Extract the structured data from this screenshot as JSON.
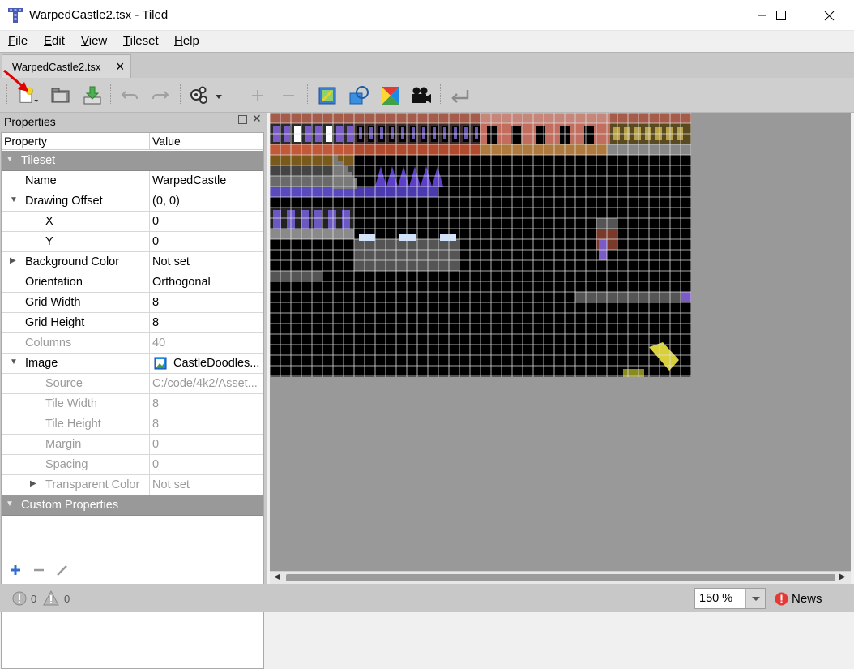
{
  "window": {
    "title": "WarpedCastle2.tsx - Tiled",
    "minimize_icon": "minimize-icon",
    "maximize_icon": "maximize-icon",
    "close_icon": "close-icon"
  },
  "menu": {
    "items": [
      {
        "label": "File",
        "access": "F"
      },
      {
        "label": "Edit",
        "access": "E"
      },
      {
        "label": "View",
        "access": "V"
      },
      {
        "label": "Tileset",
        "access": "T"
      },
      {
        "label": "Help",
        "access": "H"
      }
    ]
  },
  "tabs": [
    {
      "label": "WarpedCastle2.tsx",
      "close": "×"
    }
  ],
  "toolbar": {
    "buttons": [
      "new-file-icon",
      "open-icon",
      "save-icon",
      "undo-icon",
      "redo-icon",
      "settings-icon",
      "add-icon",
      "remove-icon",
      "embed-tileset-icon",
      "shape-icon",
      "color-icon",
      "animation-icon",
      "back-icon"
    ]
  },
  "properties_panel": {
    "title": "Properties",
    "col_property": "Property",
    "col_value": "Value",
    "rows": [
      {
        "name": "Tileset",
        "value": "",
        "kind": "group",
        "indent": 0,
        "expander": "▼"
      },
      {
        "name": "Name",
        "value": "WarpedCastle",
        "kind": "normal",
        "indent": 1,
        "expander": ""
      },
      {
        "name": "Drawing Offset",
        "value": "(0, 0)",
        "kind": "normal",
        "indent": 1,
        "expander": "▼"
      },
      {
        "name": "X",
        "value": "0",
        "kind": "normal",
        "indent": 2,
        "expander": ""
      },
      {
        "name": "Y",
        "value": "0",
        "kind": "normal",
        "indent": 2,
        "expander": ""
      },
      {
        "name": "Background Color",
        "value": "Not set",
        "kind": "normal",
        "indent": 1,
        "expander": "▶"
      },
      {
        "name": "Orientation",
        "value": "Orthogonal",
        "kind": "normal",
        "indent": 1,
        "expander": ""
      },
      {
        "name": "Grid Width",
        "value": "8",
        "kind": "normal",
        "indent": 1,
        "expander": ""
      },
      {
        "name": "Grid Height",
        "value": "8",
        "kind": "normal",
        "indent": 1,
        "expander": ""
      },
      {
        "name": "Columns",
        "value": "40",
        "kind": "dim",
        "indent": 1,
        "expander": ""
      },
      {
        "name": "Image",
        "value": "CastleDoodles...",
        "kind": "normal",
        "indent": 1,
        "expander": "▼"
      },
      {
        "name": "Source",
        "value": "C:/code/4k2/Asset...",
        "kind": "dim",
        "indent": 2,
        "expander": ""
      },
      {
        "name": "Tile Width",
        "value": "8",
        "kind": "dim",
        "indent": 2,
        "expander": ""
      },
      {
        "name": "Tile Height",
        "value": "8",
        "kind": "dim",
        "indent": 2,
        "expander": ""
      },
      {
        "name": "Margin",
        "value": "0",
        "kind": "dim",
        "indent": 2,
        "expander": ""
      },
      {
        "name": "Spacing",
        "value": "0",
        "kind": "dim",
        "indent": 2,
        "expander": ""
      },
      {
        "name": "Transparent Color",
        "value": "Not set",
        "kind": "dim",
        "indent": 2,
        "expander": "▶"
      },
      {
        "name": "Custom Properties",
        "value": "",
        "kind": "group",
        "indent": 0,
        "expander": "▼"
      }
    ],
    "bottom_buttons": [
      "add-property-icon",
      "remove-property-icon",
      "rename-property-icon"
    ]
  },
  "status": {
    "errors": "0",
    "warnings": "0",
    "zoom": "150 %",
    "news": "News"
  },
  "colors": {
    "title_bar": "#ffffff",
    "panel_bg": "#c8c8c8",
    "group_row": "#999999",
    "canvas_bg": "#999999",
    "tileset_bg": "#000000",
    "grid_line": "#e0e0e0",
    "news_badge": "#e53935"
  }
}
